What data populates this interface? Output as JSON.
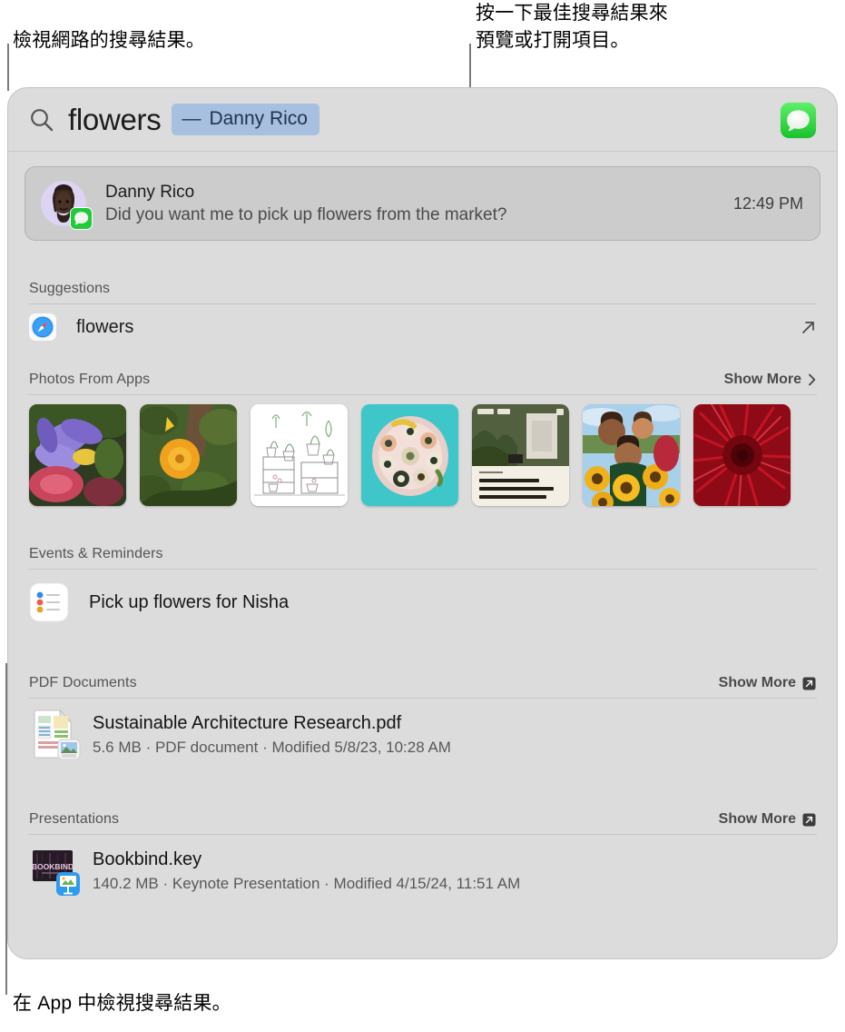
{
  "annotations": {
    "top_left": "檢視網路的搜尋結果。",
    "top_right_line1": "按一下最佳搜尋結果來",
    "top_right_line2": "預覽或打開項目。",
    "bottom_left": "在 App 中檢視搜尋結果。"
  },
  "search": {
    "icon": "search-icon",
    "query": "flowers",
    "token_dash": "—",
    "token_label": "Danny Rico",
    "app_icon": "messages-app-icon"
  },
  "top_hit": {
    "avatar": "memoji-avatar",
    "badge": "messages-badge-icon",
    "name": "Danny Rico",
    "preview": "Did you want me to pick up flowers from the market?",
    "time": "12:49 PM"
  },
  "sections": [
    {
      "id": "suggestions",
      "title": "Suggestions",
      "show_more": null,
      "rows": [
        {
          "icon": "safari-icon",
          "label": "flowers",
          "trailing_icon": "arrow-up-right-icon"
        }
      ]
    },
    {
      "id": "photos-from-apps",
      "title": "Photos From Apps",
      "show_more": {
        "label": "Show More",
        "icon": "chevron-right-icon"
      },
      "photos": [
        {
          "name": "purple-iris-photo",
          "alt": "Purple iris flowers"
        },
        {
          "name": "orange-marigold-photo",
          "alt": "Orange marigold in garden"
        },
        {
          "name": "potted-plants-illustration",
          "alt": "Illustration of potted plants on shelves"
        },
        {
          "name": "sushi-platter-photo",
          "alt": "Sushi platter on teal background"
        },
        {
          "name": "airstream-article-photo",
          "alt": "Garden article with caption"
        },
        {
          "name": "sunflower-friends-photo",
          "alt": "Two people holding sunflowers"
        },
        {
          "name": "red-gerbera-photo",
          "alt": "Close up red gerbera daisy"
        }
      ]
    },
    {
      "id": "events-and-reminders",
      "title": "Events & Reminders",
      "show_more": null,
      "rows": [
        {
          "icon": "reminders-icon",
          "label": "Pick up flowers for Nisha"
        }
      ]
    },
    {
      "id": "pdf-documents",
      "title": "PDF Documents",
      "show_more": {
        "label": "Show More",
        "icon": "boxed-arrow-icon"
      },
      "files": [
        {
          "icon": "pdf-document-icon",
          "badge": "preview-app-badge",
          "name": "Sustainable Architecture Research.pdf",
          "meta": "5.6 MB · PDF document · Modified 5/8/23, 10:28 AM"
        }
      ]
    },
    {
      "id": "presentations",
      "title": "Presentations",
      "show_more": {
        "label": "Show More",
        "icon": "boxed-arrow-icon"
      },
      "files": [
        {
          "icon": "keynote-thumbnail-icon",
          "badge": "keynote-app-badge",
          "thumb_text": "BOOKBIND",
          "name": "Bookbind.key",
          "meta": "140.2 MB · Keynote Presentation · Modified 4/15/24, 11:51 AM"
        }
      ]
    }
  ],
  "colors": {
    "panel_bg": "#dcdcdc",
    "token_bg": "#a7c0e0",
    "token_text": "#20344d",
    "tophit_bg": "#cccccc",
    "callout_line": "#7b7b7b",
    "messages_green": "#4cd964",
    "safari_blue": "#1e90f5"
  }
}
